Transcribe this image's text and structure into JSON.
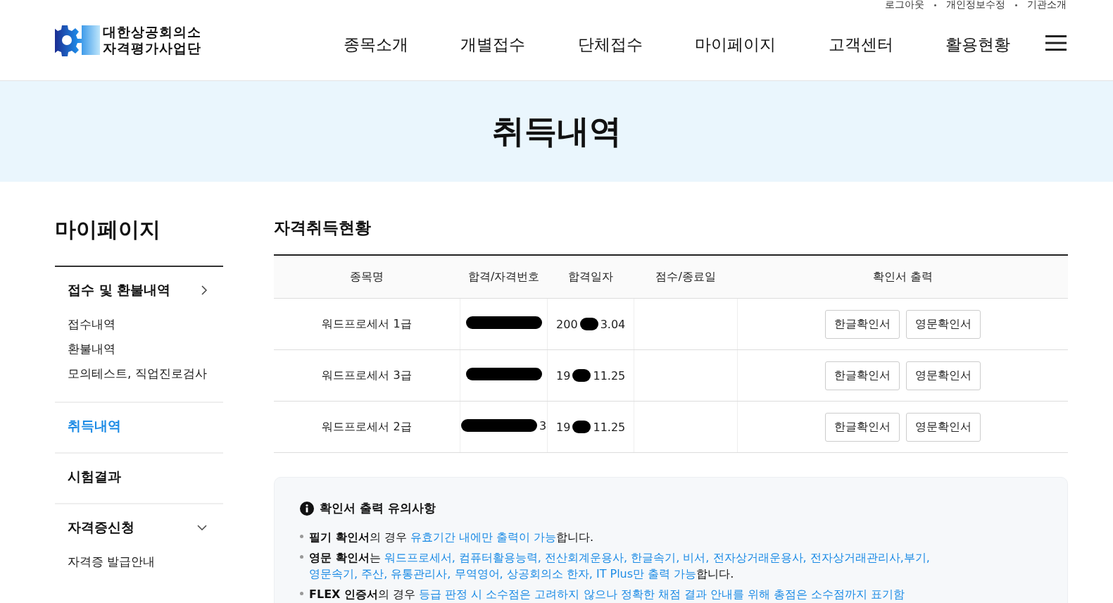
{
  "top_links": [
    "로그아웃",
    "개인정보수정",
    "기관소개"
  ],
  "logo": {
    "line1": "대한상공회의소",
    "line2": "자격평가사업단"
  },
  "nav": [
    "종목소개",
    "개별접수",
    "단체접수",
    "마이페이지",
    "고객센터",
    "활용현황"
  ],
  "banner": {
    "title": "취득내역"
  },
  "sidebar": {
    "title": "마이페이지",
    "groups": [
      {
        "label": "접수 및 환불내역",
        "kind": "arrow",
        "selected": false,
        "children": [
          {
            "label": "접수내역"
          },
          {
            "label": "환불내역"
          },
          {
            "label": "모의테스트, 직업진로검사"
          }
        ]
      },
      {
        "label": "취득내역",
        "kind": "plain",
        "selected": true
      },
      {
        "label": "시험결과",
        "kind": "plain",
        "selected": false
      },
      {
        "label": "자격증신청",
        "kind": "chevron",
        "selected": false,
        "children": [
          {
            "label": "자격증 발급안내"
          }
        ]
      }
    ]
  },
  "section_title": "자격취득현황",
  "table": {
    "columns": [
      "종목명",
      "합격/자격번호",
      "합격일자",
      "점수/종료일",
      "확인서 출력"
    ],
    "rows": [
      {
        "name": "워드프로세서 1급",
        "number_tail": "",
        "date_head": "200",
        "date_tail": "3.04",
        "buttons": [
          "한글확인서",
          "영문확인서"
        ]
      },
      {
        "name": "워드프로세서 3급",
        "number_tail": "",
        "date_head": "19",
        "date_tail": "11.25",
        "buttons": [
          "한글확인서",
          "영문확인서"
        ]
      },
      {
        "name": "워드프로세서 2급",
        "number_tail": "3",
        "date_head": "19",
        "date_tail": "11.25",
        "buttons": [
          "한글확인서",
          "영문확인서"
        ]
      }
    ]
  },
  "notice": {
    "title": "확인서 출력 유의사항",
    "items": [
      [
        {
          "kind": "bold",
          "text": "필기 확인서"
        },
        {
          "kind": "plain",
          "text": "의 경우 "
        },
        {
          "kind": "link",
          "text": "유효기간 내에만 출력이 가능"
        },
        {
          "kind": "plain",
          "text": "합니다."
        }
      ],
      [
        {
          "kind": "bold",
          "text": "영문 확인서"
        },
        {
          "kind": "plain",
          "text": "는 "
        },
        {
          "kind": "link",
          "text": "워드프로세서, 컴퓨터활용능력, 전산회계운용사, 한글속기, 비서, 전자상거래운용사, 전자상거래관리사,부기, 영문속기, 주산, 유통관리사, 무역영어, 상공회의소 한자, IT Plus만 출력 가능"
        },
        {
          "kind": "plain",
          "text": "합니다."
        }
      ],
      [
        {
          "kind": "bold",
          "text": "FLEX 인증서"
        },
        {
          "kind": "plain",
          "text": "의 경우 "
        },
        {
          "kind": "link",
          "text": "등급 판정 시 소수점은 고려하지 않으나 정확한 채점 결과 안내를 위해 총점은 소수점까지 표기함"
        }
      ]
    ]
  }
}
